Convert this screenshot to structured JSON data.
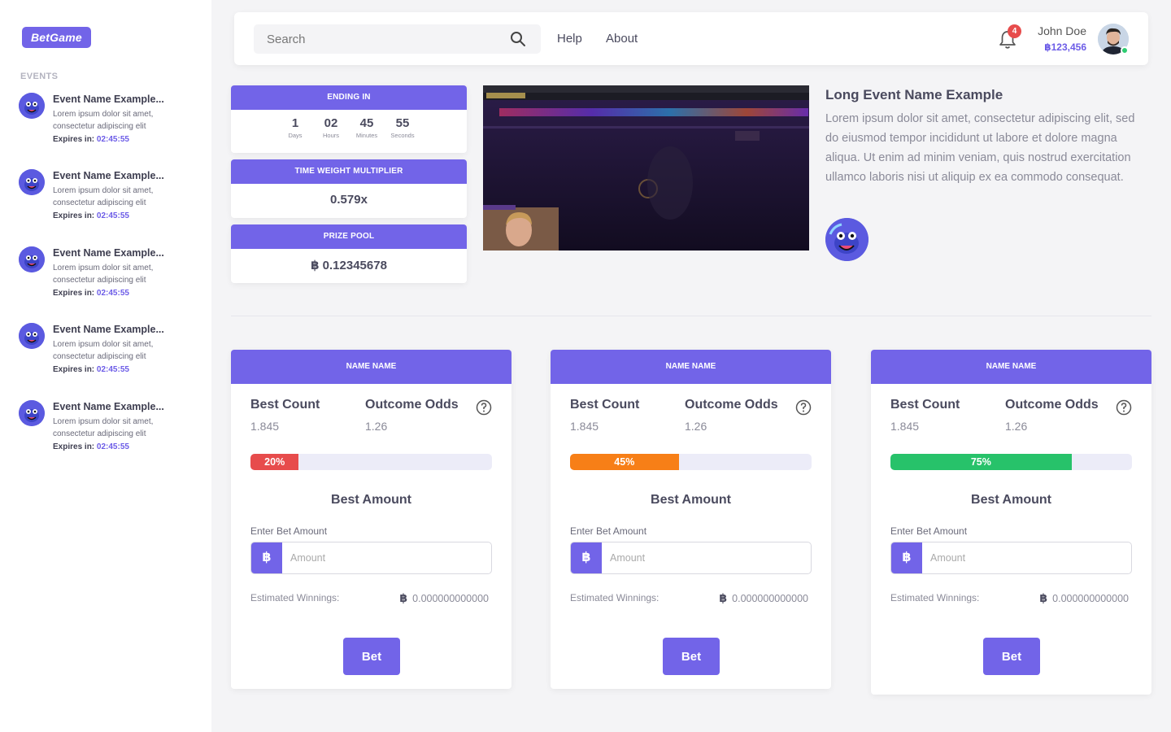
{
  "brand": {
    "logo": "BetGame",
    "accent": "#7264e8"
  },
  "sidebar": {
    "title": "EVENTS",
    "items": [
      {
        "name": "Event Name Example...",
        "desc": "Lorem ipsum dolor sit amet, consectetur adipiscing elit",
        "expires_label": "Expires in:",
        "expires_time": "02:45:55"
      },
      {
        "name": "Event Name Example...",
        "desc": "Lorem ipsum dolor sit amet, consectetur adipiscing elit",
        "expires_label": "Expires in:",
        "expires_time": "02:45:55"
      },
      {
        "name": "Event Name Example...",
        "desc": "Lorem ipsum dolor sit amet, consectetur adipiscing elit",
        "expires_label": "Expires in:",
        "expires_time": "02:45:55"
      },
      {
        "name": "Event Name Example...",
        "desc": "Lorem ipsum dolor sit amet, consectetur adipiscing elit",
        "expires_label": "Expires in:",
        "expires_time": "02:45:55"
      },
      {
        "name": "Event Name Example...",
        "desc": "Lorem ipsum dolor sit amet, consectetur adipiscing elit",
        "expires_label": "Expires in:",
        "expires_time": "02:45:55"
      }
    ]
  },
  "header": {
    "search_placeholder": "Search",
    "nav": [
      "Help",
      "About"
    ],
    "notifications": "4",
    "user_name": "John Doe",
    "balance": "123,456",
    "currency_symbol": "฿"
  },
  "stats": {
    "ending": {
      "title": "ENDING IN",
      "units": [
        {
          "value": "1",
          "label": "Days"
        },
        {
          "value": "02",
          "label": "Hours"
        },
        {
          "value": "45",
          "label": "Minutes"
        },
        {
          "value": "55",
          "label": "Seconds"
        }
      ]
    },
    "multiplier": {
      "title": "TIME WEIGHT MULTIPLIER",
      "value": "0.579x"
    },
    "prize": {
      "title": "PRIZE POOL",
      "value": "0.12345678"
    }
  },
  "event": {
    "title": "Long Event Name Example",
    "text": "Lorem ipsum dolor sit amet, consectetur adipiscing elit, sed do eiusmod tempor incididunt ut labore et dolore magna aliqua. Ut enim ad minim veniam, quis nostrud exercitation ullamco laboris nisi ut aliquip ex ea commodo consequat."
  },
  "cards": [
    {
      "header": "NAME NAME",
      "best_count_label": "Best Count",
      "best_count": "1.845",
      "odds_label": "Outcome Odds",
      "odds": "1.26",
      "progress_label": "20%",
      "progress": 0.2,
      "color": "#e74c4c",
      "amount_title": "Best Amount",
      "enter_label": "Enter Bet Amount",
      "placeholder": "Amount",
      "est_label": "Estimated Winnings:",
      "est_value": "0.000000000000",
      "bet_label": "Bet"
    },
    {
      "header": "NAME NAME",
      "best_count_label": "Best Count",
      "best_count": "1.845",
      "odds_label": "Outcome Odds",
      "odds": "1.26",
      "progress_label": "45%",
      "progress": 0.45,
      "color": "#f77f17",
      "amount_title": "Best Amount",
      "enter_label": "Enter Bet Amount",
      "placeholder": "Amount",
      "est_label": "Estimated Winnings:",
      "est_value": "0.000000000000",
      "bet_label": "Bet"
    },
    {
      "header": "NAME NAME",
      "best_count_label": "Best Count",
      "best_count": "1.845",
      "odds_label": "Outcome Odds",
      "odds": "1.26",
      "progress_label": "75%",
      "progress": 0.75,
      "color": "#27c26a",
      "amount_title": "Best Amount",
      "enter_label": "Enter Bet Amount",
      "placeholder": "Amount",
      "est_label": "Estimated Winnings:",
      "est_value": "0.000000000000",
      "bet_label": "Bet"
    }
  ]
}
